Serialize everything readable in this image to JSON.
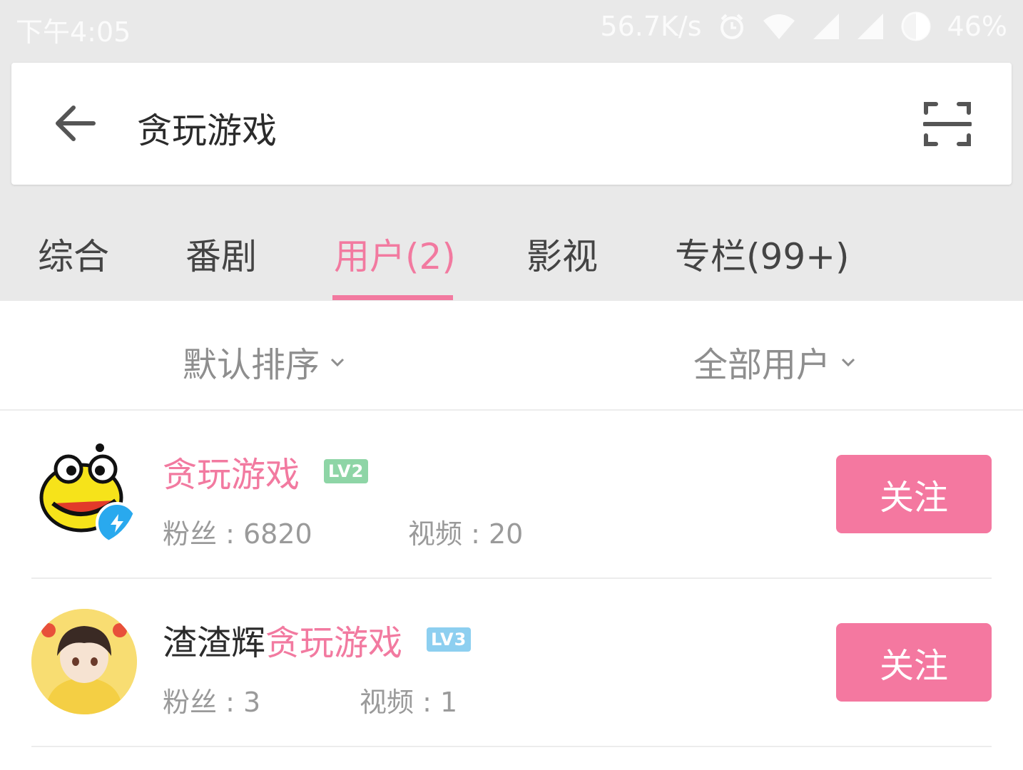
{
  "status_bar": {
    "time": "下午4:05",
    "net_speed": "56.7K/s",
    "battery": "46%",
    "icons": [
      "alarm-icon",
      "wifi-icon",
      "signal-icon",
      "signal-icon",
      "battery-icon"
    ]
  },
  "search": {
    "query": "贪玩游戏",
    "back_icon": "back-arrow-icon",
    "scan_icon": "scan-icon"
  },
  "tabs": [
    {
      "label": "综合",
      "active": false
    },
    {
      "label": "番剧",
      "active": false
    },
    {
      "label": "用户(2)",
      "active": true
    },
    {
      "label": "影视",
      "active": false
    },
    {
      "label": "专栏(99+)",
      "active": false
    }
  ],
  "filters": {
    "sort": "默认排序",
    "user_type": "全部用户"
  },
  "users": [
    {
      "name_prefix": "",
      "name_highlight": "贪玩游戏",
      "level": "LV2",
      "level_color": "#8ed5a6",
      "fans": "粉丝 : 6820",
      "videos": "视频 : 20",
      "verified": true,
      "follow_label": "关注"
    },
    {
      "name_prefix": "渣渣辉",
      "name_highlight": "贪玩游戏",
      "level": "LV3",
      "level_color": "#8dcff0",
      "fans": "粉丝 : 3",
      "videos": "视频 : 1",
      "verified": false,
      "follow_label": "关注"
    }
  ],
  "colors": {
    "accent": "#f27aa0",
    "follow_button": "#f478a0",
    "header_bg": "#e9e9e9"
  }
}
